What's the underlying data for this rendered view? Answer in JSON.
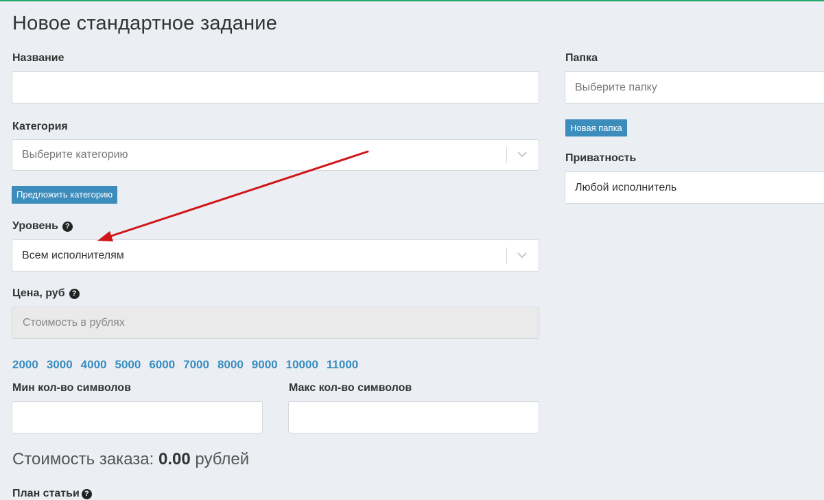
{
  "page_title": "Новое стандартное задание",
  "form": {
    "name_label": "Название",
    "name_value": "",
    "category_label": "Категория",
    "category_placeholder": "Выберите категорию",
    "suggest_category_button": "Предложить категорию",
    "level_label": "Уровень",
    "level_value": "Всем исполнителям",
    "price_label": "Цена, руб",
    "price_placeholder": "Стоимость в рублях",
    "price_presets": [
      "2000",
      "3000",
      "4000",
      "5000",
      "6000",
      "7000",
      "8000",
      "9000",
      "10000",
      "11000"
    ],
    "min_chars_label": "Мин кол-во символов",
    "max_chars_label": "Макс кол-во символов",
    "cost_prefix": "Стоимость заказа:",
    "cost_value": "0.00",
    "cost_suffix": "рублей",
    "plan_label": "План статьи"
  },
  "side": {
    "folder_label": "Папка",
    "folder_placeholder": "Выберите папку",
    "new_folder_button": "Новая папка",
    "privacy_label": "Приватность",
    "privacy_value": "Любой исполнитель"
  },
  "colors": {
    "accent": "#3c8dbc",
    "link": "#3a8dc1",
    "annotation_arrow": "#d0161b",
    "top_line": "#27a86b"
  },
  "icons": [
    "help-icon",
    "chevron-down-icon",
    "annotation-arrow"
  ]
}
